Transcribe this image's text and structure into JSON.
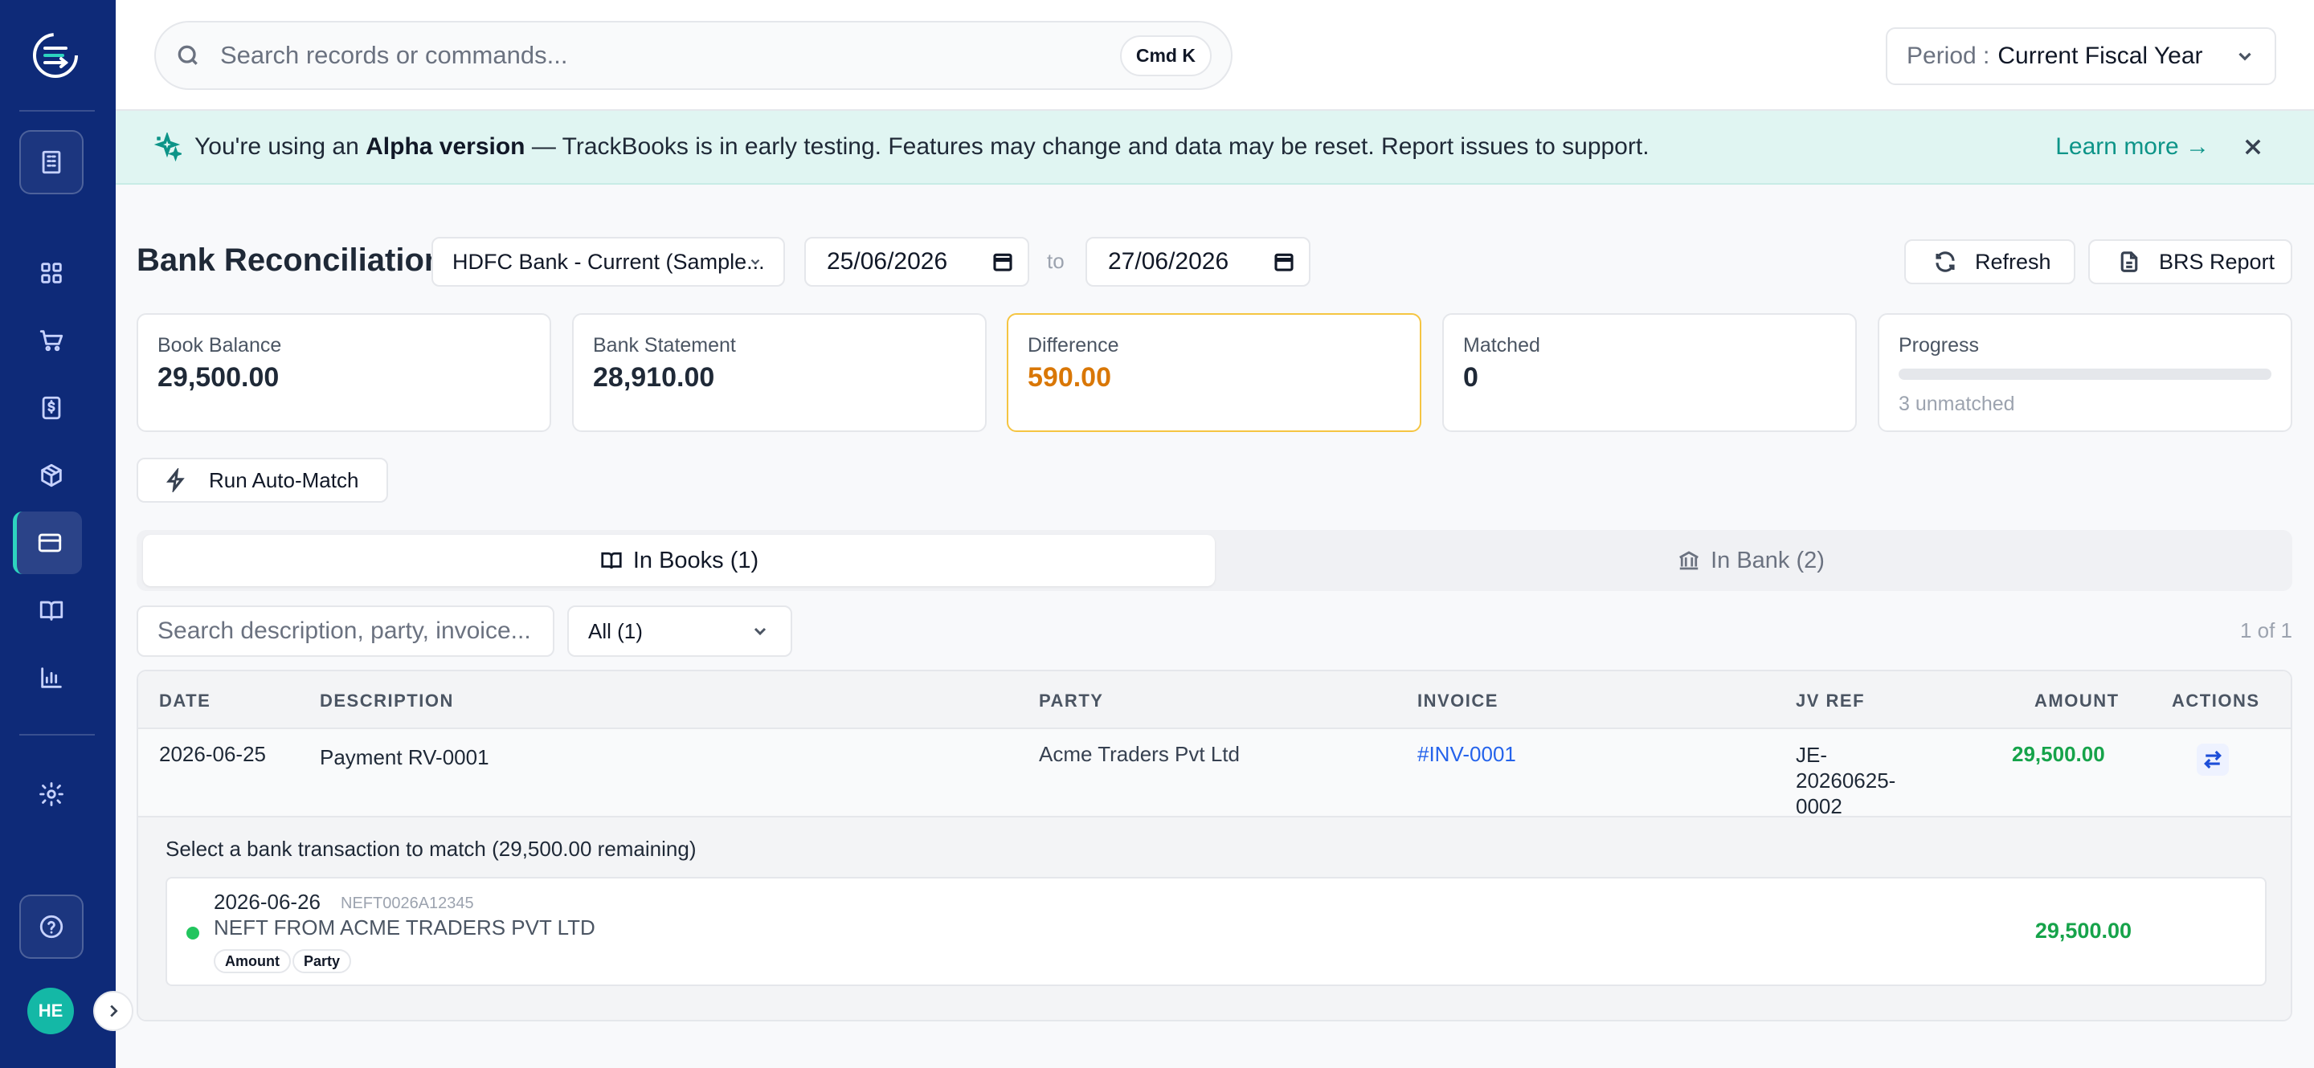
{
  "topbar": {
    "search_placeholder": "Search records or commands...",
    "shortcut": "Cmd K",
    "period_label": "Period :",
    "period_value": "Current Fiscal Year"
  },
  "banner": {
    "prefix": "You're using an ",
    "highlight": "Alpha version",
    "suffix": " — TrackBooks is in early testing. Features may change and data may be reset. Report issues to support.",
    "link": "Learn more →"
  },
  "sidebar": {
    "avatar_initials": "HE"
  },
  "page": {
    "title": "Bank Reconciliation",
    "bank_account": "HDFC Bank - Current (Sample...",
    "date_from": "25/06/2026",
    "to_label": "to",
    "date_to": "27/06/2026",
    "refresh_label": "Refresh",
    "brs_label": "BRS Report",
    "automatch_label": "Run Auto-Match"
  },
  "stats": [
    {
      "label": "Book Balance",
      "value": "29,500.00"
    },
    {
      "label": "Bank Statement",
      "value": "28,910.00"
    },
    {
      "label": "Difference",
      "value": "590.00"
    },
    {
      "label": "Matched",
      "value": "0"
    },
    {
      "label": "Progress",
      "sub": "3 unmatched",
      "progress": 0
    }
  ],
  "tabs": [
    {
      "label": "In Books (1)",
      "active": true
    },
    {
      "label": "In Bank (2)",
      "active": false
    }
  ],
  "filters": {
    "search_placeholder": "Search description, party, invoice...",
    "status_value": "All (1)",
    "pager": "1 of 1"
  },
  "table": {
    "columns": [
      "DATE",
      "DESCRIPTION",
      "PARTY",
      "INVOICE",
      "JV REF",
      "AMOUNT",
      "ACTIONS"
    ],
    "rows": [
      {
        "date": "2026-06-25",
        "description": "Payment RV-0001",
        "party": "Acme Traders Pvt Ltd",
        "invoice": "#INV-0001",
        "jv_ref_lines": [
          "JE-",
          "20260625-",
          "0002"
        ],
        "amount": "29,500.00"
      }
    ]
  },
  "match": {
    "title": "Select a bank transaction to match (29,500.00 remaining)",
    "candidate": {
      "date": "2026-06-26",
      "ref": "NEFT0026A12345",
      "description": "NEFT FROM ACME TRADERS PVT LTD",
      "tags": [
        "Amount",
        "Party"
      ],
      "amount": "29,500.00"
    }
  },
  "colors": {
    "sidebar": "#0e2a78",
    "accent": "#14b8a6",
    "positive": "#16a34a",
    "warning": "#d97706",
    "link": "#2563eb"
  }
}
